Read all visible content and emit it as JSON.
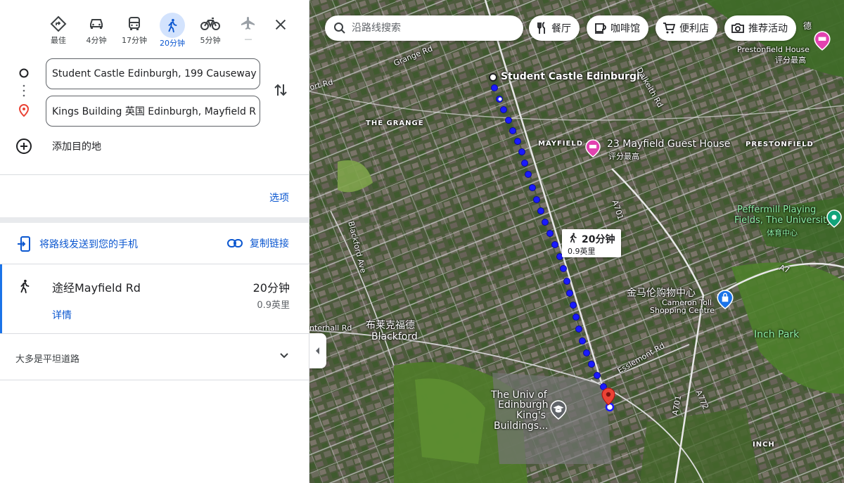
{
  "modes": [
    {
      "label": "最佳",
      "icon": "best-route-icon"
    },
    {
      "label": "4分钟",
      "icon": "car-icon"
    },
    {
      "label": "17分钟",
      "icon": "bus-icon"
    },
    {
      "label": "20分钟",
      "icon": "walk-icon",
      "active": true
    },
    {
      "label": "5分钟",
      "icon": "bicycle-icon"
    },
    {
      "label": "—",
      "icon": "flight-icon"
    }
  ],
  "waypoints": {
    "origin": "Student Castle Edinburgh, 199 Causeway",
    "destination": "Kings Building 英国 Edinburgh, Mayfield R",
    "add_destination": "添加目的地"
  },
  "options_label": "选项",
  "share": {
    "send_to_phone": "将路线发送到您的手机",
    "copy_link": "复制链接"
  },
  "route": {
    "title": "途经Mayfield Rd",
    "time": "20分钟",
    "distance": "0.9英里",
    "details": "详情",
    "terrain": "大多是平坦道路"
  },
  "map": {
    "search_placeholder": "沿路线搜索",
    "chips": [
      "餐厅",
      "咖啡馆",
      "便利店",
      "推荐活动"
    ],
    "info_time": "20分钟",
    "info_distance": "0.9英里",
    "labels": {
      "origin": "Student Castle Edinburgh",
      "the_grange": "THE GRANGE",
      "mayfield": "MAYFIELD",
      "guest_house": "23 Mayfield Guest House",
      "guest_house_sub": "评分最高",
      "prestonfield": "PRESTONFIELD",
      "prestonfield_house": "Prestonfield House",
      "prestonfield_house_sub": "评分最高",
      "peffermill_1": "Peffermill Playing",
      "peffermill_2": "Fields, The University...",
      "peffermill_sub": "体育中心",
      "mall_cn": "金马伦购物中心",
      "mall_1": "Cameron Toll",
      "mall_2": "Shopping Centre",
      "blackford_cn": "布莱克福德",
      "blackford": "Blackford",
      "inch_park": "Inch Park",
      "inch": "INCH",
      "uni_1": "The Univ of",
      "uni_2": "Edinburgh",
      "uni_3": "King's",
      "uni_4": "Buildings...",
      "grange_rd": "Grange Rd",
      "dalkeith_rd": "Dalkeith Rd",
      "blackford_ave": "Blackford Ave",
      "esslemont_rd": "Esslemont Rd",
      "a7": "A7",
      "a701": "A701",
      "a701b": "A701",
      "a772": "A772",
      "nterhall_rd": "nterhall Rd",
      "fort_rd": "ort Rd",
      "hedge": "德"
    }
  },
  "colors": {
    "accent": "#0b57d0",
    "route": "#1a1aff",
    "destination_pin": "#ea4335",
    "hotel_pin": "#e242b0"
  }
}
